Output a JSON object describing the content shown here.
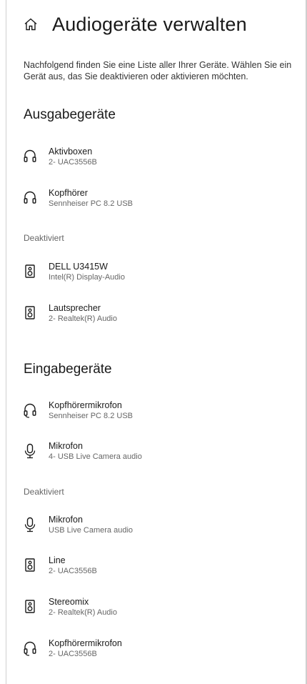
{
  "header": {
    "title": "Audiogeräte verwalten",
    "icon": "home-icon"
  },
  "description": "Nachfolgend finden Sie eine Liste aller Ihrer Geräte. Wählen Sie ein Gerät aus, das Sie deaktivieren oder aktivieren möchten.",
  "output": {
    "heading": "Ausgabegeräte",
    "active": [
      {
        "name": "Aktivboxen",
        "detail": "2- UAC3556B",
        "icon": "headphone-icon"
      },
      {
        "name": "Kopfhörer",
        "detail": "Sennheiser PC 8.2 USB",
        "icon": "headphone-icon"
      }
    ],
    "disabled_label": "Deaktiviert",
    "disabled": [
      {
        "name": "DELL U3415W",
        "detail": "Intel(R) Display-Audio",
        "icon": "speaker-icon"
      },
      {
        "name": "Lautsprecher",
        "detail": "2- Realtek(R) Audio",
        "icon": "speaker-icon"
      }
    ]
  },
  "input": {
    "heading": "Eingabegeräte",
    "active": [
      {
        "name": "Kopfhörermikrofon",
        "detail": "Sennheiser PC 8.2 USB",
        "icon": "headset-icon"
      },
      {
        "name": "Mikrofon",
        "detail": "4- USB Live Camera audio",
        "icon": "microphone-icon"
      }
    ],
    "disabled_label": "Deaktiviert",
    "disabled": [
      {
        "name": "Mikrofon",
        "detail": "USB Live Camera audio",
        "icon": "microphone-icon"
      },
      {
        "name": "Line",
        "detail": "2- UAC3556B",
        "icon": "speaker-icon"
      },
      {
        "name": "Stereomix",
        "detail": "2- Realtek(R) Audio",
        "icon": "speaker-icon"
      },
      {
        "name": "Kopfhörermikrofon",
        "detail": "2- UAC3556B",
        "icon": "headset-icon"
      }
    ]
  }
}
